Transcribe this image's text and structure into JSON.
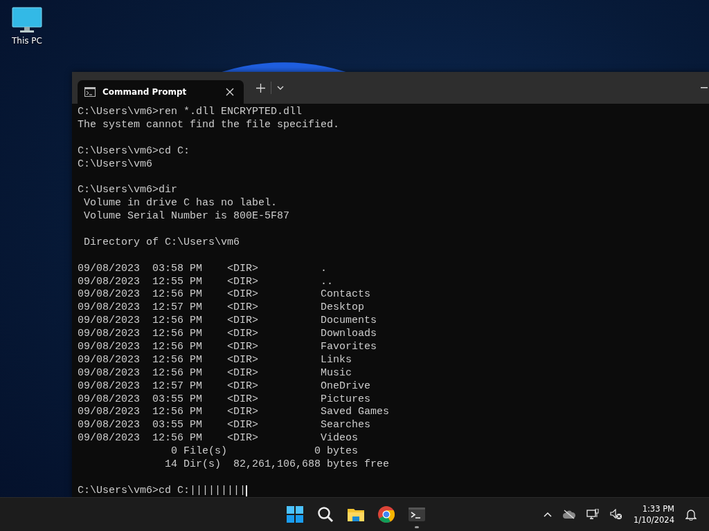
{
  "desktop": {
    "icons": [
      {
        "label": "This PC"
      }
    ]
  },
  "window": {
    "tab": {
      "title": "Command Prompt",
      "selected": true
    }
  },
  "terminal": {
    "blocks": [
      [
        "C:\\Users\\vm6>ren *.dll ENCRYPTED.dll",
        "The system cannot find the file specified."
      ],
      [
        "C:\\Users\\vm6>cd C:",
        "C:\\Users\\vm6"
      ],
      [
        "C:\\Users\\vm6>dir",
        " Volume in drive C has no label.",
        " Volume Serial Number is 800E-5F87"
      ],
      [
        " Directory of C:\\Users\\vm6"
      ],
      [
        "09/08/2023  03:58 PM    <DIR>          .",
        "09/08/2023  12:55 PM    <DIR>          ..",
        "09/08/2023  12:56 PM    <DIR>          Contacts",
        "09/08/2023  12:57 PM    <DIR>          Desktop",
        "09/08/2023  12:56 PM    <DIR>          Documents",
        "09/08/2023  12:56 PM    <DIR>          Downloads",
        "09/08/2023  12:56 PM    <DIR>          Favorites",
        "09/08/2023  12:56 PM    <DIR>          Links",
        "09/08/2023  12:56 PM    <DIR>          Music",
        "09/08/2023  12:57 PM    <DIR>          OneDrive",
        "09/08/2023  03:55 PM    <DIR>          Pictures",
        "09/08/2023  12:56 PM    <DIR>          Saved Games",
        "09/08/2023  03:55 PM    <DIR>          Searches",
        "09/08/2023  12:56 PM    <DIR>          Videos",
        "               0 File(s)              0 bytes",
        "              14 Dir(s)  82,261,106,688 bytes free"
      ],
      [
        "C:\\Users\\vm6>cd C:|||||||||"
      ]
    ]
  },
  "taskbar": {
    "apps": [
      {
        "kind": "start",
        "active": false
      },
      {
        "kind": "search",
        "active": false
      },
      {
        "kind": "files",
        "active": false
      },
      {
        "kind": "browser",
        "active": false
      },
      {
        "kind": "terminal",
        "active": true
      }
    ],
    "tray": {
      "time": "1:33 PM",
      "date": "1/10/2024"
    }
  }
}
